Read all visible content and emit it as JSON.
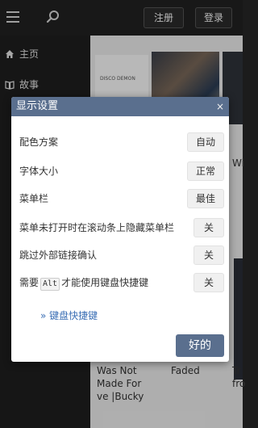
{
  "topbar": {
    "register_label": "注册",
    "login_label": "登录"
  },
  "sidebar": {
    "items": [
      {
        "label": "主页",
        "icon": "home-icon"
      },
      {
        "label": "故事",
        "icon": "book-icon"
      }
    ]
  },
  "background": {
    "thumb_tag": "DISCO DEMON",
    "text_wi": "Wi",
    "title1": "Was Not Made For ve |Bucky",
    "faded": "Faded",
    "tr": "Tr",
    "fro": "fro"
  },
  "dialog": {
    "title": "显示设置",
    "close_label": "×",
    "rows": [
      {
        "label": "配色方案",
        "value": "自动"
      },
      {
        "label": "字体大小",
        "value": "正常"
      },
      {
        "label": "菜单栏",
        "value": "最佳"
      },
      {
        "label": "菜单未打开时在滚动条上隐藏菜单栏",
        "value": "关"
      },
      {
        "label": "跳过外部链接确认",
        "value": "关"
      },
      {
        "label_prefix": "需要",
        "kbd": "Alt",
        "label_suffix": "才能使用键盘快捷键",
        "value": "关"
      }
    ],
    "shortcuts_link": "» 键盘快捷键",
    "ok_label": "好的"
  },
  "colors": {
    "accent": "#5a6f8e",
    "link": "#3b6fb5"
  }
}
